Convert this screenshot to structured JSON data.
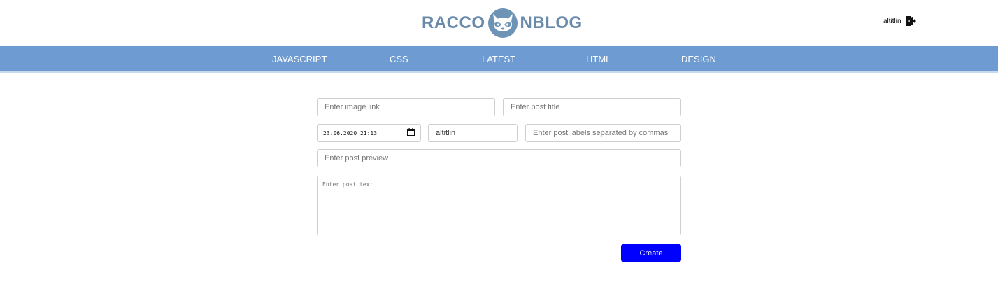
{
  "header": {
    "logo_left": "RACCO",
    "logo_right": "NBLOG",
    "username": "altitlin"
  },
  "nav": {
    "items": [
      "JAVASCRIPT",
      "CSS",
      "LATEST",
      "HTML",
      "DESIGN"
    ]
  },
  "form": {
    "image_link_placeholder": "Enter image link",
    "post_title_placeholder": "Enter post title",
    "date_value": "23.06.2020 21:13",
    "author_value": "altitlin",
    "labels_placeholder": "Enter post labels separated by commas",
    "preview_placeholder": "Enter post preview",
    "text_placeholder": "Enter post text",
    "create_label": "Create"
  },
  "colors": {
    "nav": "#6e9bd1",
    "logo": "#6a8aab",
    "button": "#0000ff"
  },
  "icons": {
    "logo": "raccoon-icon",
    "logout": "logout-icon",
    "calendar": "calendar-icon"
  }
}
